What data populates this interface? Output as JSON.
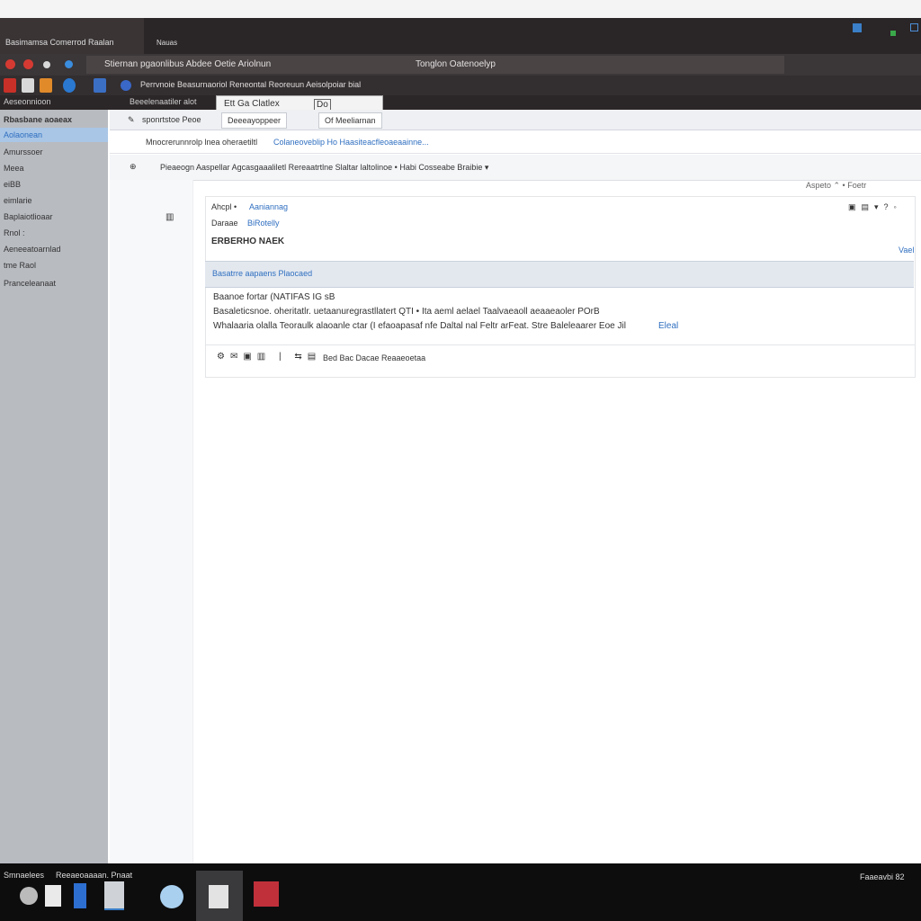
{
  "colors": {
    "titlebar": "#2a2526",
    "sidebar": "#b8bbc0",
    "selection": "#a9c6e6",
    "link": "#2f6fc0",
    "taskbar": "#0d0d0e"
  },
  "titlebar": {
    "tab_label": "Basimamsa Comerrod Raalan",
    "tab2_label": "Nauas"
  },
  "address": {
    "text": "Stiernan pgaonlibus Abdee Oetie Ariolnun",
    "right_text": "Tonglon Oatenoelyp"
  },
  "toolbar": {
    "items_text": "Perrvnoie Beasurnaoriol Reneontal Reoreuun Aeisolpoiar bial"
  },
  "subtool": {
    "left": "Aeseonnioon",
    "mid": "Beeelenaatiler alot"
  },
  "popup": {
    "item1": "Ett Ga Clatlex",
    "item2": "Do"
  },
  "sidebar": {
    "header": "Rbasbane aoaeax",
    "items": [
      "Aolaonean",
      "Amurssoer",
      "Meea",
      "eiBB",
      "eimlarie",
      "Baplaiotlioaar",
      "Rnol :",
      "Aeneeatoarnlad",
      "tme Raol",
      "Pranceleanaat"
    ]
  },
  "tabs": {
    "t1": "sponrtstoe Peoe",
    "t2": "Deeeayoppeer",
    "t3": "Of Meeliarnan"
  },
  "row2": {
    "text": "Mnocrerunnrolp lnea oheraetiltl",
    "link": "Colaneoveblip Ho Haasiteacfleoaeaainne..."
  },
  "row3": {
    "text": "Pieaeogn Aaspellar Agcasgaaaliletl Rereaatrtlne Slaltar laltolinoe • Habi Cosseabe Braibie ▾"
  },
  "card": {
    "toolbar": "Aspeto ⌃ • Foetr",
    "from_label": "Ahcpl •",
    "from_value": "Aaniannag",
    "to_label": "Daraae",
    "to_value": "BiRotelly",
    "title": "ERBERHO NAEK",
    "right_link": "Vael",
    "subject": "Basatrre aapaens Plaocaed",
    "body_line1": "Baanoe fortar (NATIFAS IG sB",
    "body_line2": "Basaleticsnoe. oheritatlr. uetaanuregrastllatert QTI • Ita aeml aelael Taalvaeaoll aeaaeaoler POrB",
    "body_line3": "Whalaaria olalla Teoraulk alaoanle ctar (I efaoapasaf nfe Daltal nal Feltr arFeat. Stre Baleleaarer Eoe Jil",
    "body_link": "Eleal",
    "footer": "Bed Bac Dacae Reaaeoetaa"
  },
  "taskbar": {
    "label1": "Smnaelees",
    "label2": "Reeaeoaaaan. Pnaat",
    "clock": "Faaeavbi 82"
  }
}
